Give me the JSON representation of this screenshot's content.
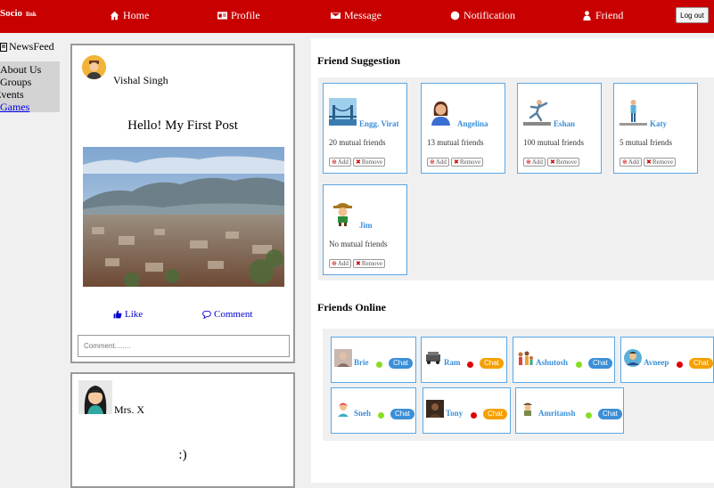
{
  "brand": {
    "name": "Socio",
    "tag": "link"
  },
  "nav": {
    "home": "Home",
    "profile": "Profile",
    "message": "Message",
    "notification": "Notification",
    "friend": "Friend",
    "logout": "Log out"
  },
  "sidebar": {
    "newsfeed": "NewsFeed",
    "items": [
      "About Us",
      "Groups",
      "Events",
      "Games"
    ]
  },
  "posts": [
    {
      "author": "Vishal Singh",
      "text": "Hello! My First Post",
      "like": "Like",
      "comment": "Comment",
      "comment_placeholder": "Comment........"
    },
    {
      "author": "Mrs. X",
      "text": ":)"
    }
  ],
  "suggestions": {
    "title": "Friend Suggestion",
    "add_label": "Add",
    "remove_label": "Remove",
    "cards": [
      {
        "name": "Engg. Virat",
        "mutual": "20 mutual friends"
      },
      {
        "name": "Angelina",
        "mutual": "13 mutual friends"
      },
      {
        "name": "Eshan",
        "mutual": "100 mutual friends"
      },
      {
        "name": "Katy",
        "mutual": "5 mutual friends"
      },
      {
        "name": "Jim",
        "mutual": "No mutual friends"
      }
    ]
  },
  "online": {
    "title": "Friends Online",
    "chat_label": "Chat",
    "friends": [
      {
        "name": "Brie",
        "status": "online"
      },
      {
        "name": "Ram",
        "status": "busy"
      },
      {
        "name": "Ashutosh",
        "status": "online"
      },
      {
        "name": "Avneep",
        "status": "busy"
      },
      {
        "name": "Sneh",
        "status": "online"
      },
      {
        "name": "Tony",
        "status": "busy"
      },
      {
        "name": "Amritansh",
        "status": "online"
      }
    ]
  },
  "colors": {
    "topbar": "#c80000",
    "link": "#3b8fd8",
    "online": "#88dd22",
    "busy": "#dd0000",
    "chat_blue": "#3b8fd8",
    "chat_orange": "#f5a000"
  }
}
